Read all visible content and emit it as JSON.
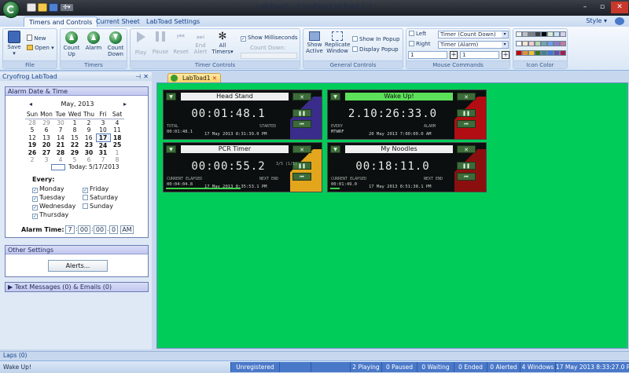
{
  "window": {
    "title": "LabToad1 - Cryofrog LabToad 1.1"
  },
  "ribbon": {
    "tabs": [
      "Timers and Controls",
      "Current Sheet",
      "LabToad Settings"
    ],
    "style_label": "Style",
    "groups": {
      "file": {
        "label": "File",
        "save": "Save",
        "new": "New",
        "open": "Open"
      },
      "timers": {
        "label": "Timers",
        "count_up": "Count Up",
        "alarm": "Alarm",
        "count_down": "Count Down"
      },
      "timer_controls": {
        "label": "Timer Controls",
        "play": "Play",
        "pause": "Pause",
        "reset": "Reset",
        "end_alert": "End Alert",
        "all_timers": "All Timers",
        "show_ms": "Show Milliseconds",
        "count_down": "Count Down:"
      },
      "general_controls": {
        "label": "General Controls",
        "show_active": "Show Active",
        "replicate_window": "Replicate Window",
        "show_in_popup": "Show In Popup",
        "display_popup": "Display Popup"
      },
      "mouse_commands": {
        "label": "Mouse Commands",
        "left": "Left",
        "right": "Right",
        "left_value": "Timer (Count Down)",
        "right_value": "Timer (Alarm)",
        "num1": "1",
        "num2": "1"
      },
      "icon_color": {
        "label": "Icon Color"
      }
    }
  },
  "icon_colors": [
    "#f2f2f2",
    "#bfbfbf",
    "#7f7f7f",
    "#404040",
    "#000000",
    "#d9ead3",
    "#cfe2f3",
    "#d9d2e9",
    "#ffffff",
    "#fce5cd",
    "#f4cccc",
    "#b6d7a8",
    "#76a5af",
    "#6d9eeb",
    "#8e7cc3",
    "#c27ba0",
    "#cc0000",
    "#e69138",
    "#f1c232",
    "#38761d",
    "#45818e",
    "#3c78d8",
    "#674ea7",
    "#a61c4d"
  ],
  "left_panel": {
    "title": "Cryofrog LabToad",
    "alarm_section": {
      "title": "Alarm Date & Time",
      "month": "May, 2013",
      "weekdays": [
        "Sun",
        "Mon",
        "Tue",
        "Wed",
        "Thu",
        "Fri",
        "Sat"
      ],
      "weeks": [
        [
          "28",
          "29",
          "30",
          "1",
          "2",
          "3",
          "4"
        ],
        [
          "5",
          "6",
          "7",
          "8",
          "9",
          "10",
          "11"
        ],
        [
          "12",
          "13",
          "14",
          "15",
          "16",
          "17",
          "18"
        ],
        [
          "19",
          "20",
          "21",
          "22",
          "23",
          "24",
          "25"
        ],
        [
          "26",
          "27",
          "28",
          "29",
          "30",
          "31",
          "1"
        ],
        [
          "2",
          "3",
          "4",
          "5",
          "6",
          "7",
          "8"
        ]
      ],
      "today": "Today: 5/17/2013",
      "every_label": "Every:",
      "days": [
        {
          "label": "Monday",
          "checked": true
        },
        {
          "label": "Friday",
          "checked": true
        },
        {
          "label": "Tuesday",
          "checked": true
        },
        {
          "label": "Saturday",
          "checked": false
        },
        {
          "label": "Wednesday",
          "checked": true
        },
        {
          "label": "Sunday",
          "checked": false
        },
        {
          "label": "Thursday",
          "checked": true
        }
      ],
      "alarm_time_label": "Alarm Time:",
      "alarm_time": {
        "hour": "7",
        "minute": "00",
        "second": "00",
        "ms": "0",
        "ampm": "AM"
      }
    },
    "other_settings": {
      "title": "Other Settings",
      "alerts_button": "Alerts..."
    },
    "messages": {
      "title": "Text Messages (0) & Emails (0)"
    }
  },
  "document_tab": {
    "label": "LabToad1"
  },
  "timers": [
    {
      "name": "Head Stand",
      "time": "00:01:48.1",
      "left_label": "TOTAL",
      "right_label": "STARTED",
      "left_value": "00:01:48.1",
      "info": "17 May 2013 8:31:39.0 PM",
      "deco": "#3a2c8a",
      "highlight": false
    },
    {
      "name": "Wake Up!",
      "time": "2.10:26:33.0",
      "left_label": "EVERY",
      "right_label": "ALARM",
      "left_value": "MTWRF",
      "info": "20 May 2013 7:00:00.0 AM",
      "deco": "#b20d12",
      "highlight": true
    },
    {
      "name": "PCR Timer",
      "time": "00:00:55.2",
      "left_label": "CURRENT ELAPSED",
      "right_label": "NEXT END",
      "left_value": "00:04:04.8",
      "info": "17 May 2013 8:35:53.1 PM",
      "extra": "3/5 (1/1)",
      "deco": "#e3a51c",
      "highlight": false
    },
    {
      "name": "My Noodles",
      "time": "00:18:11.0",
      "left_label": "CURRENT ELAPSED",
      "right_label": "NEXT END",
      "left_value": "00:01:49.0",
      "info": "17 May 2013 8:51:38.1 PM",
      "deco": "#8c0f10",
      "highlight": false
    }
  ],
  "laps": {
    "label": "Laps (0)"
  },
  "status": {
    "message": "Wake Up!",
    "registration": "Unregistered",
    "playing": "2 Playing",
    "paused": "0 Paused",
    "waiting": "0 Waiting",
    "ended": "0 Ended",
    "alerted": "0 Alerted",
    "windows": "4 Windows",
    "datetime": "17 May 2013 8:33:27.0 PM"
  }
}
